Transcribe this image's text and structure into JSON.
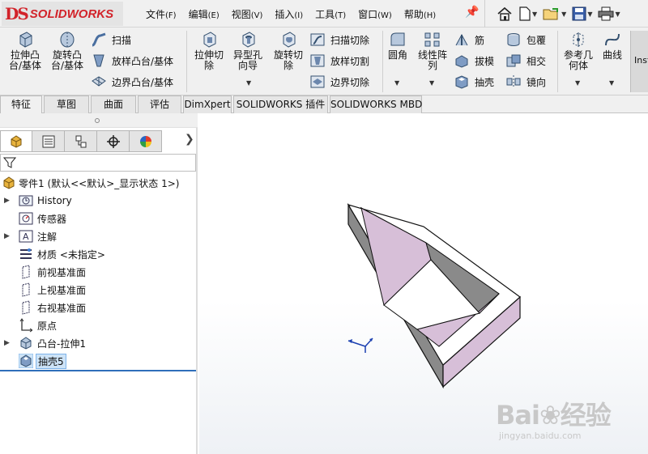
{
  "app": {
    "logo_mark": "DS",
    "logo_text": "SOLIDWORKS"
  },
  "menu": [
    {
      "label": "文件",
      "key": "(F)"
    },
    {
      "label": "编辑",
      "key": "(E)"
    },
    {
      "label": "视图",
      "key": "(V)"
    },
    {
      "label": "插入",
      "key": "(I)"
    },
    {
      "label": "工具",
      "key": "(T)"
    },
    {
      "label": "窗口",
      "key": "(W)"
    },
    {
      "label": "帮助",
      "key": "(H)"
    }
  ],
  "quick_access": [
    "home-icon",
    "new-document-icon",
    "open-folder-icon",
    "save-icon",
    "print-icon"
  ],
  "ribbon": {
    "extrude_boss": [
      "拉伸凸",
      "台/基体"
    ],
    "revolve_boss": [
      "旋转凸",
      "台/基体"
    ],
    "sweep": "扫描",
    "loft_boss": "放样凸台/基体",
    "boundary_boss": "边界凸台/基体",
    "extrude_cut": [
      "拉伸切",
      "除"
    ],
    "hole_wizard": [
      "异型孔",
      "向导"
    ],
    "revolve_cut": [
      "旋转切",
      "除"
    ],
    "swept_cut": "扫描切除",
    "lofted_cut": "放样切割",
    "boundary_cut": "边界切除",
    "fillet": "圆角",
    "linear_pattern": [
      "线性阵",
      "列"
    ],
    "rib": "筋",
    "draft": "拔模",
    "shell": "抽壳",
    "wrap": "包覆",
    "intersect": "相交",
    "mirror": "镜向",
    "ref_geometry": [
      "参考几",
      "何体"
    ],
    "curves": "曲线",
    "instant3d": "Insta"
  },
  "tabs": [
    "特征",
    "草图",
    "曲面",
    "评估",
    "DimXpert",
    "SOLIDWORKS 插件",
    "SOLIDWORKS MBD"
  ],
  "tree": {
    "root": "零件1 (默认<<默认>_显示状态 1>)",
    "items": [
      {
        "label": "History",
        "expandable": true
      },
      {
        "label": "传感器",
        "expandable": false
      },
      {
        "label": "注解",
        "expandable": true
      },
      {
        "label": "材质 <未指定>",
        "expandable": false
      },
      {
        "label": "前视基准面",
        "expandable": false
      },
      {
        "label": "上视基准面",
        "expandable": false
      },
      {
        "label": "右视基准面",
        "expandable": false
      },
      {
        "label": "原点",
        "expandable": false
      },
      {
        "label": "凸台-拉伸1",
        "expandable": true
      },
      {
        "label": "抽壳5",
        "expandable": false,
        "selected": true
      }
    ]
  },
  "colors": {
    "brand": "#d2232a",
    "selection": "#cde3f7",
    "shell_inner_face": "#d7bfd8",
    "model_side_face": "#8a8a8a",
    "tree_bar": "#2f6fba"
  },
  "watermark": {
    "brand": "Bai",
    "brand2": "经验",
    "url": "jingyan.baidu.com"
  }
}
